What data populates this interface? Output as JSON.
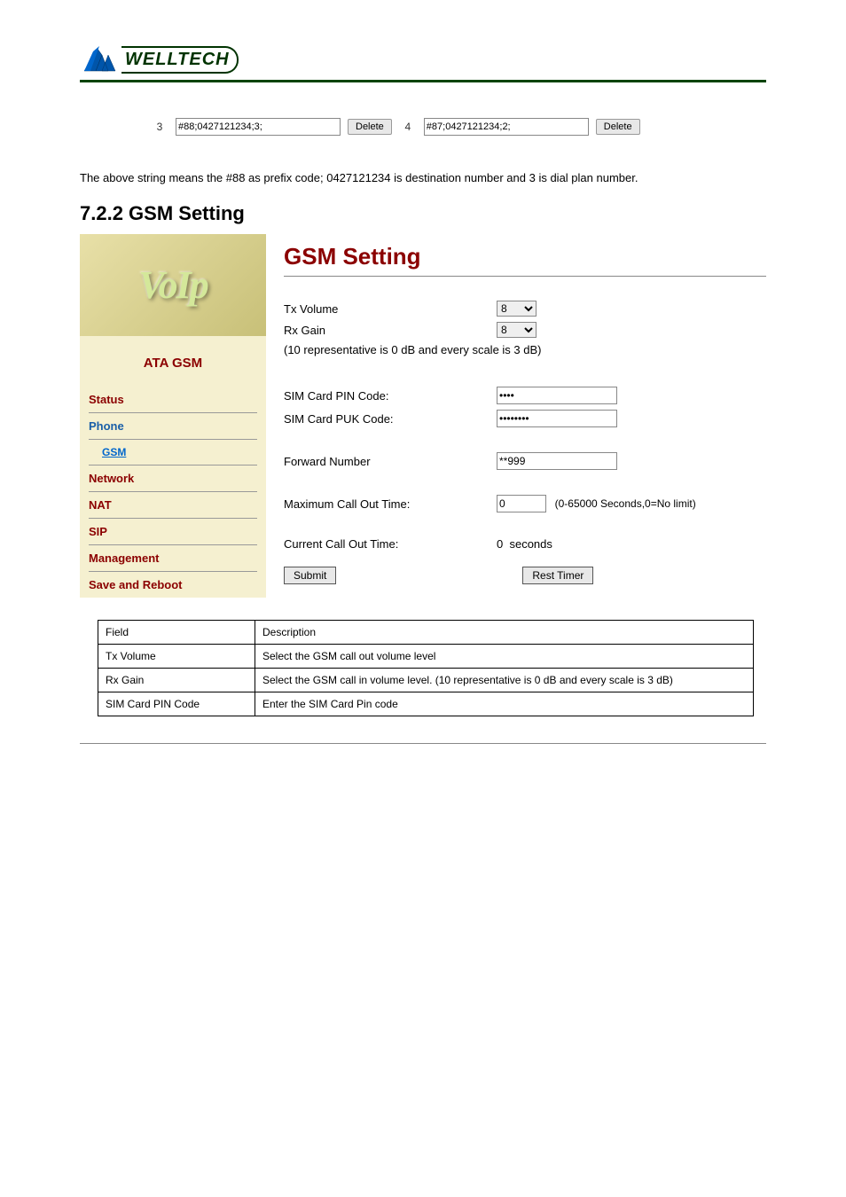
{
  "strip": {
    "num_left": "3",
    "value_left": "#88;0427121234;3;",
    "delete_left": "Delete",
    "num_right": "4",
    "value_right": "#87;0427121234;2;",
    "delete_right": "Delete"
  },
  "string_note": "The above string means the #88 as prefix code; 0427121234 is destination number and 3 is dial plan number.",
  "gsm_section_heading": "7.2.2 GSM Setting",
  "voip_brand": "VoIp",
  "sidebar_title": "ATA GSM",
  "nav": {
    "status": "Status",
    "phone": "Phone",
    "gsm": "GSM",
    "network": "Network",
    "nat": "NAT",
    "sip": "SIP",
    "management": "Management",
    "save_reboot": "Save and Reboot"
  },
  "content": {
    "title": "GSM Setting",
    "tx_volume_label": "Tx Volume",
    "tx_volume_value": "8",
    "rx_gain_label": "Rx Gain",
    "rx_gain_value": "8",
    "scale_note": "(10 representative is 0 dB and every scale is 3 dB)",
    "pin_label": "SIM Card PIN Code:",
    "pin_value": "●●●●",
    "puk_label": "SIM Card PUK Code:",
    "puk_value": "●●●●●●●●",
    "forward_label": "Forward Number",
    "forward_value": "**999",
    "max_call_label": "Maximum Call Out Time:",
    "max_call_value": "0",
    "max_call_hint": "(0-65000 Seconds,0=No limit)",
    "current_call_label": "Current Call Out Time:",
    "current_call_value": "0",
    "current_call_unit": "seconds",
    "submit_btn": "Submit",
    "rest_timer_btn": "Rest Timer"
  },
  "desc_table": {
    "h1": "Field",
    "h2": "Description",
    "rows": [
      [
        "Tx Volume",
        "Select the GSM call out volume level"
      ],
      [
        "Rx Gain",
        "Select the GSM call in volume level. (10 representative is 0 dB and every scale is 3 dB)"
      ],
      [
        "SIM Card PIN Code",
        "Enter the SIM Card Pin code"
      ]
    ]
  }
}
